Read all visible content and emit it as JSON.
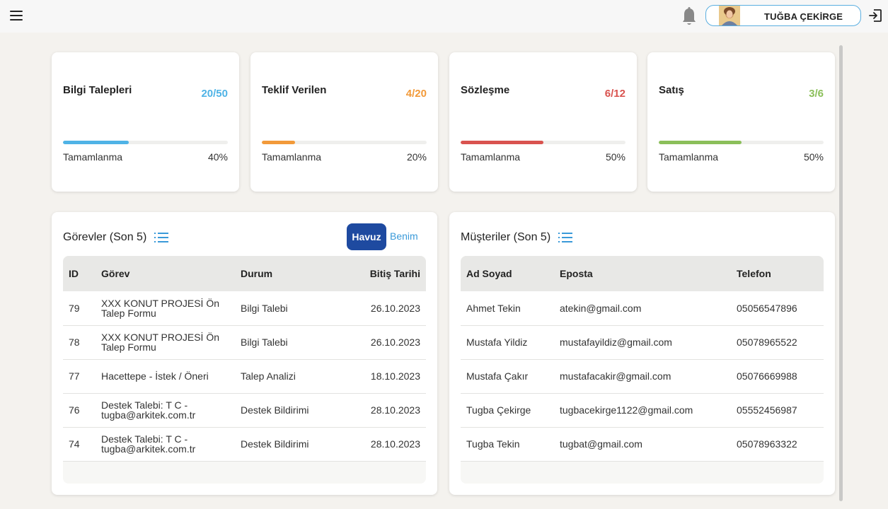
{
  "header": {
    "user_name": "TUĞBA ÇEKİRGE"
  },
  "stats": [
    {
      "title": "Bilgi Talepleri",
      "value": "20/50",
      "label": "Tamamlanma",
      "percent": "40%",
      "progress": 0.4,
      "color": "#4fb3e6"
    },
    {
      "title": "Teklif Verilen",
      "value": "4/20",
      "label": "Tamamlanma",
      "percent": "20%",
      "progress": 0.2,
      "color": "#f29a3a"
    },
    {
      "title": "Sözleşme",
      "value": "6/12",
      "label": "Tamamlanma",
      "percent": "50%",
      "progress": 0.5,
      "color": "#d9534f"
    },
    {
      "title": "Satış",
      "value": "3/6",
      "label": "Tamamlanma",
      "percent": "50%",
      "progress": 0.5,
      "color": "#8bbf5a"
    }
  ],
  "tasks": {
    "title": "Görevler (Son 5)",
    "havuz_label": "Havuz",
    "benim_label": "Benim",
    "columns": [
      "ID",
      "Görev",
      "Durum",
      "Bitiş Tarihi"
    ],
    "rows": [
      {
        "id": "79",
        "task": "XXX KONUT PROJESİ Ön Talep Formu",
        "status": "Bilgi Talebi",
        "date": "26.10.2023"
      },
      {
        "id": "78",
        "task": "XXX KONUT PROJESİ Ön Talep Formu",
        "status": "Bilgi Talebi",
        "date": "26.10.2023"
      },
      {
        "id": "77",
        "task": "Hacettepe - İstek / Öneri",
        "status": "Talep Analizi",
        "date": "18.10.2023"
      },
      {
        "id": "76",
        "task": "Destek Talebi: T C - tugba@arkitek.com.tr",
        "status": "Destek Bildirimi",
        "date": "28.10.2023"
      },
      {
        "id": "74",
        "task": "Destek Talebi: T C - tugba@arkitek.com.tr",
        "status": "Destek Bildirimi",
        "date": "28.10.2023"
      }
    ]
  },
  "customers": {
    "title": "Müşteriler (Son 5)",
    "columns": [
      "Ad Soyad",
      "Eposta",
      "Telefon"
    ],
    "rows": [
      {
        "name": "Ahmet Tekin",
        "email": "atekin@gmail.com",
        "phone": "05056547896"
      },
      {
        "name": "Mustafa Yildiz",
        "email": "mustafayildiz@gmail.com",
        "phone": "05078965522"
      },
      {
        "name": "Mustafa Çakır",
        "email": "mustafacakir@gmail.com",
        "phone": "05076669988"
      },
      {
        "name": "Tugba Çekirge",
        "email": "tugbacekirge1122@gmail.com",
        "phone": "05552456987"
      },
      {
        "name": "Tugba Tekin",
        "email": "tugbat@gmail.com",
        "phone": "05078963322"
      }
    ]
  }
}
